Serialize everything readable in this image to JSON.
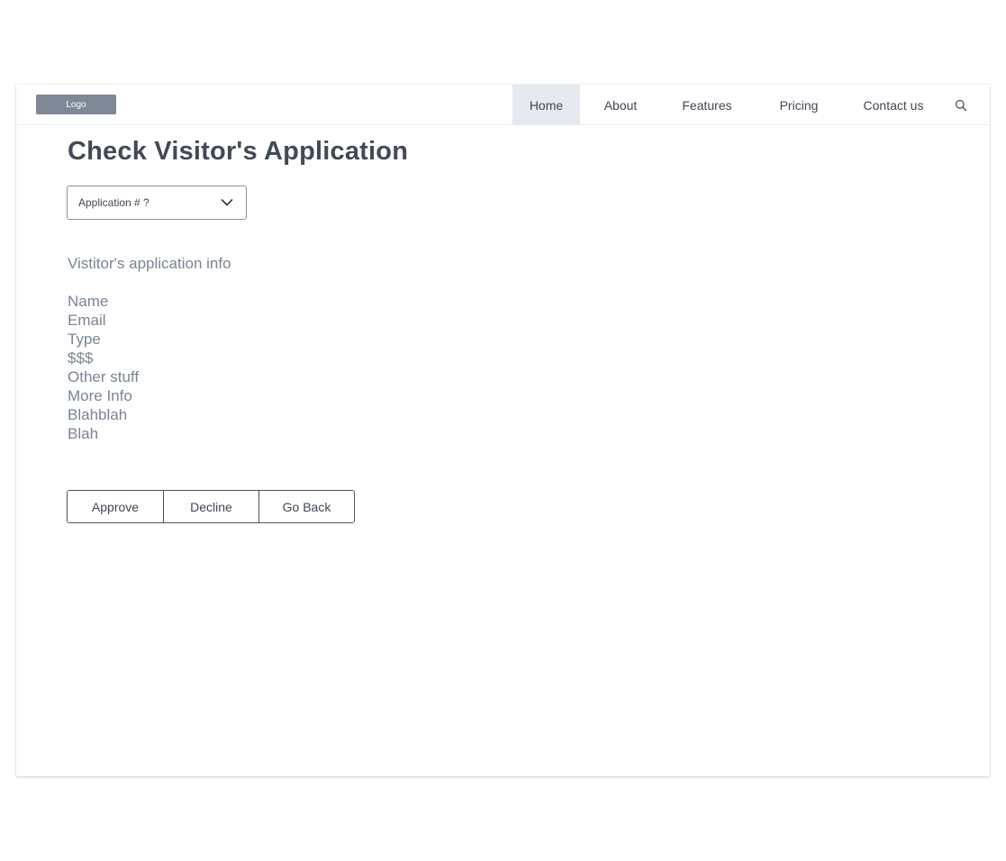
{
  "navbar": {
    "logo": "Logo",
    "items": [
      {
        "label": "Home",
        "active": true
      },
      {
        "label": "About",
        "active": false
      },
      {
        "label": "Features",
        "active": false
      },
      {
        "label": "Pricing",
        "active": false
      },
      {
        "label": "Contact us",
        "active": false
      }
    ],
    "search_icon": "search-icon"
  },
  "page": {
    "title": "Check Visitor's Application",
    "dropdown": {
      "selected": "Application # ?",
      "icon": "chevron-down-icon"
    },
    "section_heading": "Vistitor's application info",
    "info_fields": [
      "Name",
      "Email",
      "Type",
      "$$$",
      "Other stuff",
      "More Info",
      "Blahblah",
      "Blah"
    ],
    "actions": {
      "approve": "Approve",
      "decline": "Decline",
      "go_back": "Go Back"
    }
  },
  "colors": {
    "nav_active_bg": "#e6e9ef",
    "logo_bg": "#7f8897",
    "title_text": "#434a56",
    "muted_text": "#7a8493"
  }
}
